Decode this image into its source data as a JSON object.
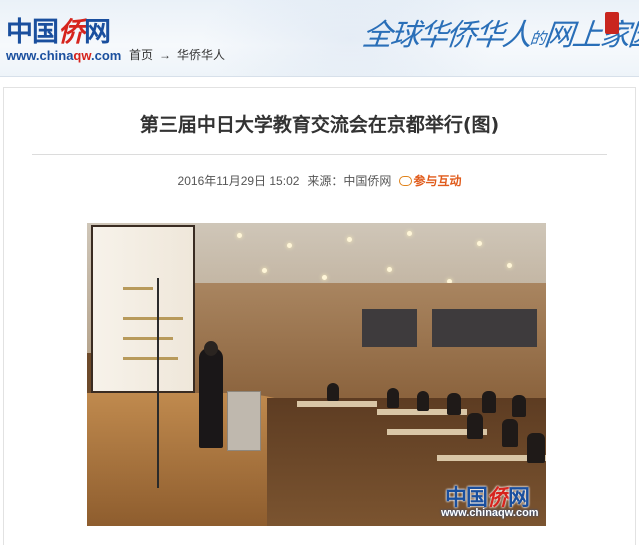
{
  "header": {
    "logo": {
      "cn_part1": "中国",
      "cn_part2": "侨",
      "cn_part3": "网",
      "url_part1": "www.china",
      "url_part2": "qw",
      "url_part3": ".com"
    },
    "breadcrumb": {
      "home": "首页",
      "arrow": "→",
      "section": "华侨华人"
    },
    "slogan": {
      "part1": "全球华侨华人",
      "part2": "的",
      "part3": "网上家园"
    }
  },
  "article": {
    "title": "第三届中日大学教育交流会在京都举行(图)",
    "date": "2016年11月29日 15:02",
    "source": "来源：中国侨网",
    "interact_label": "参与互动"
  },
  "photo": {
    "watermark": {
      "cn_part1": "中国",
      "cn_part2": "侨",
      "cn_part3": "网",
      "url": "www.chinaqw.com"
    }
  },
  "colors": {
    "brand_blue": "#1a4f9e",
    "brand_red": "#d6241d",
    "interact_orange": "#e05a1a"
  }
}
